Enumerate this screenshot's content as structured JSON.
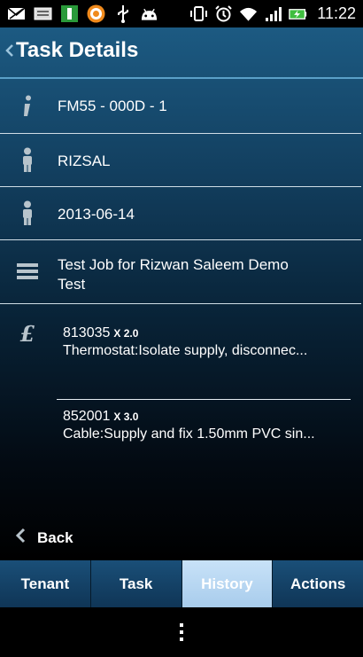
{
  "statusbar": {
    "time": "11:22",
    "icons_left": [
      "mail-icon",
      "screen-icon",
      "app-i-icon",
      "orange-app-icon",
      "usb-icon",
      "android-debug-icon"
    ],
    "icons_right": [
      "vibrate-icon",
      "alarm-icon",
      "wifi-icon",
      "signal-icon",
      "battery-charging-icon"
    ]
  },
  "header": {
    "title": "Task Details"
  },
  "details": {
    "reference": "FM55 - 000D - 1",
    "person": "RIZSAL",
    "date": "2013-06-14",
    "description_line1": "Test Job for Rizwan Saleem Demo",
    "description_line2": "Test"
  },
  "items": [
    {
      "code": "813035",
      "qty": "X 2.0",
      "desc": "Thermostat:Isolate supply, disconnec..."
    },
    {
      "code": "852001",
      "qty": "X 3.0",
      "desc": "Cable:Supply and fix 1.50mm PVC sin..."
    }
  ],
  "back": {
    "label": "Back"
  },
  "tabs": [
    {
      "label": "Tenant",
      "active": false
    },
    {
      "label": "Task",
      "active": false
    },
    {
      "label": "History",
      "active": true
    },
    {
      "label": "Actions",
      "active": false
    }
  ],
  "colors": {
    "accent": "#5aa0c8",
    "tab_active": "#b4d4f0",
    "tab_inactive": "#134266"
  }
}
